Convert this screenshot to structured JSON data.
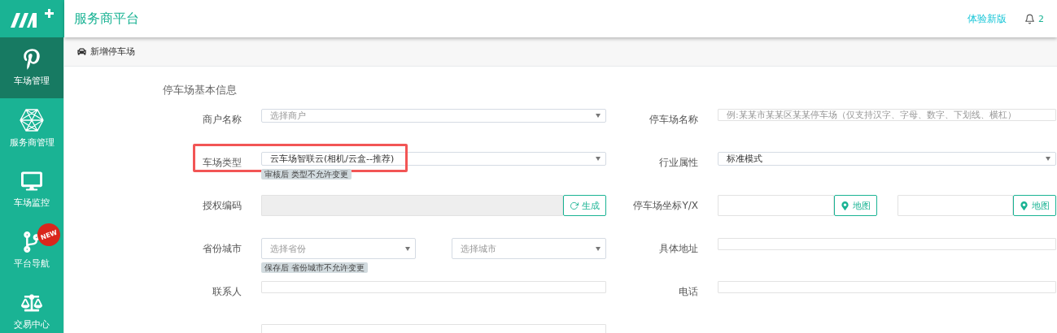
{
  "header": {
    "title": "服务商平台",
    "link": "体验新版",
    "notification_count": "2"
  },
  "sidebar": {
    "items": [
      {
        "label": "车场管理",
        "selected": true
      },
      {
        "label": "服务商管理",
        "selected": false
      },
      {
        "label": "车场监控",
        "selected": false
      },
      {
        "label": "平台导航",
        "selected": false,
        "badge": "NEW"
      },
      {
        "label": "交易中心",
        "selected": false
      }
    ]
  },
  "breadcrumb": "新增停车场",
  "form": {
    "title": "停车场基本信息",
    "rows": [
      {
        "left": {
          "label": "商户名称",
          "kind": "select",
          "placeholder": "选择商户"
        },
        "right": {
          "label": "停车场名称",
          "kind": "text",
          "placeholder": "例:某某市某某区某某停车场（仅支持汉字、字母、数字、下划线、横杠）"
        }
      },
      {
        "left": {
          "label": "车场类型",
          "kind": "select",
          "value": "云车场智联云(相机/云盒--推荐)",
          "hint": "审核后 类型不允许变更",
          "highlighted": true
        },
        "right": {
          "label": "行业属性",
          "kind": "select",
          "value": "标准模式"
        }
      },
      {
        "left": {
          "label": "授权编码",
          "kind": "code",
          "button": "生成"
        },
        "right": {
          "label": "停车场坐标Y/X",
          "kind": "coordinates",
          "buttons": [
            "地图",
            "地图"
          ]
        }
      },
      {
        "left": {
          "label": "省份城市",
          "kind": "pair",
          "placeholders": [
            "选择省份",
            "选择城市"
          ],
          "hint": "保存后 省份城市不允许变更"
        },
        "right": {
          "label": "具体地址",
          "kind": "text"
        }
      },
      {
        "left": {
          "label": "联系人",
          "kind": "text"
        },
        "right": {
          "label": "电话",
          "kind": "text"
        }
      },
      {
        "left": {
          "kind": "text"
        }
      }
    ]
  }
}
